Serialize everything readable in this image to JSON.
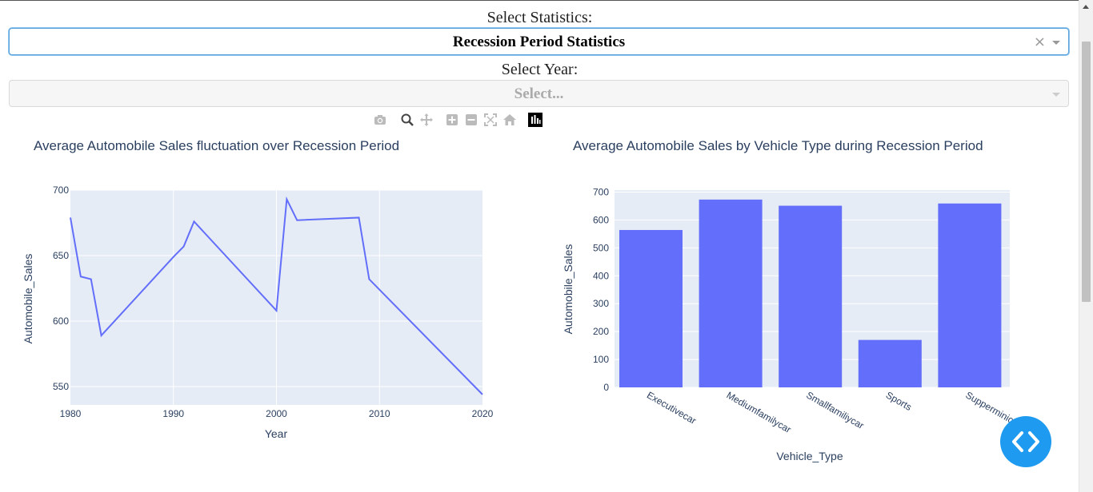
{
  "controls": {
    "statistics_label": "Select Statistics:",
    "statistics_value": "Recession Period Statistics",
    "statistics_clear": "×",
    "year_label": "Select Year:",
    "year_placeholder": "Select..."
  },
  "modebar": {
    "icons": [
      "camera-icon",
      "zoom-icon",
      "pan-icon",
      "zoom-in-icon",
      "zoom-out-icon",
      "autoscale-icon",
      "reset-axes-icon",
      "plotly-logo-icon"
    ]
  },
  "colors": {
    "series": "#636efa",
    "plot_bg": "#e5ecf6",
    "text": "#2a3f5f",
    "fab": "#1e9bf0"
  },
  "chart_data": [
    {
      "type": "line",
      "title": "Average Automobile Sales fluctuation over Recession Period",
      "xlabel": "Year",
      "ylabel": "Automobile_Sales",
      "x": [
        1980,
        1981,
        1982,
        1983,
        1990,
        1991,
        1992,
        2000,
        2001,
        2002,
        2008,
        2009,
        2020
      ],
      "y": [
        679,
        634,
        632,
        589,
        649,
        657,
        676,
        608,
        693,
        677,
        679,
        632,
        544
      ],
      "xlim": [
        1980,
        2020
      ],
      "ylim": [
        536,
        700
      ],
      "xticks": [
        1980,
        1990,
        2000,
        2010,
        2020
      ],
      "yticks": [
        550,
        600,
        650,
        700
      ],
      "grid": true
    },
    {
      "type": "bar",
      "title": "Average Automobile Sales by Vehicle Type during Recession Period",
      "xlabel": "Vehicle_Type",
      "ylabel": "Automobile_Sales",
      "categories": [
        "Executivecar",
        "Mediumfamilycar",
        "Smallfamiliycar",
        "Sports",
        "Supperminicar"
      ],
      "values": [
        564,
        673,
        651,
        170,
        659
      ],
      "ylim": [
        0,
        707
      ],
      "yticks": [
        0,
        100,
        200,
        300,
        400,
        500,
        600,
        700
      ],
      "grid": true
    }
  ]
}
